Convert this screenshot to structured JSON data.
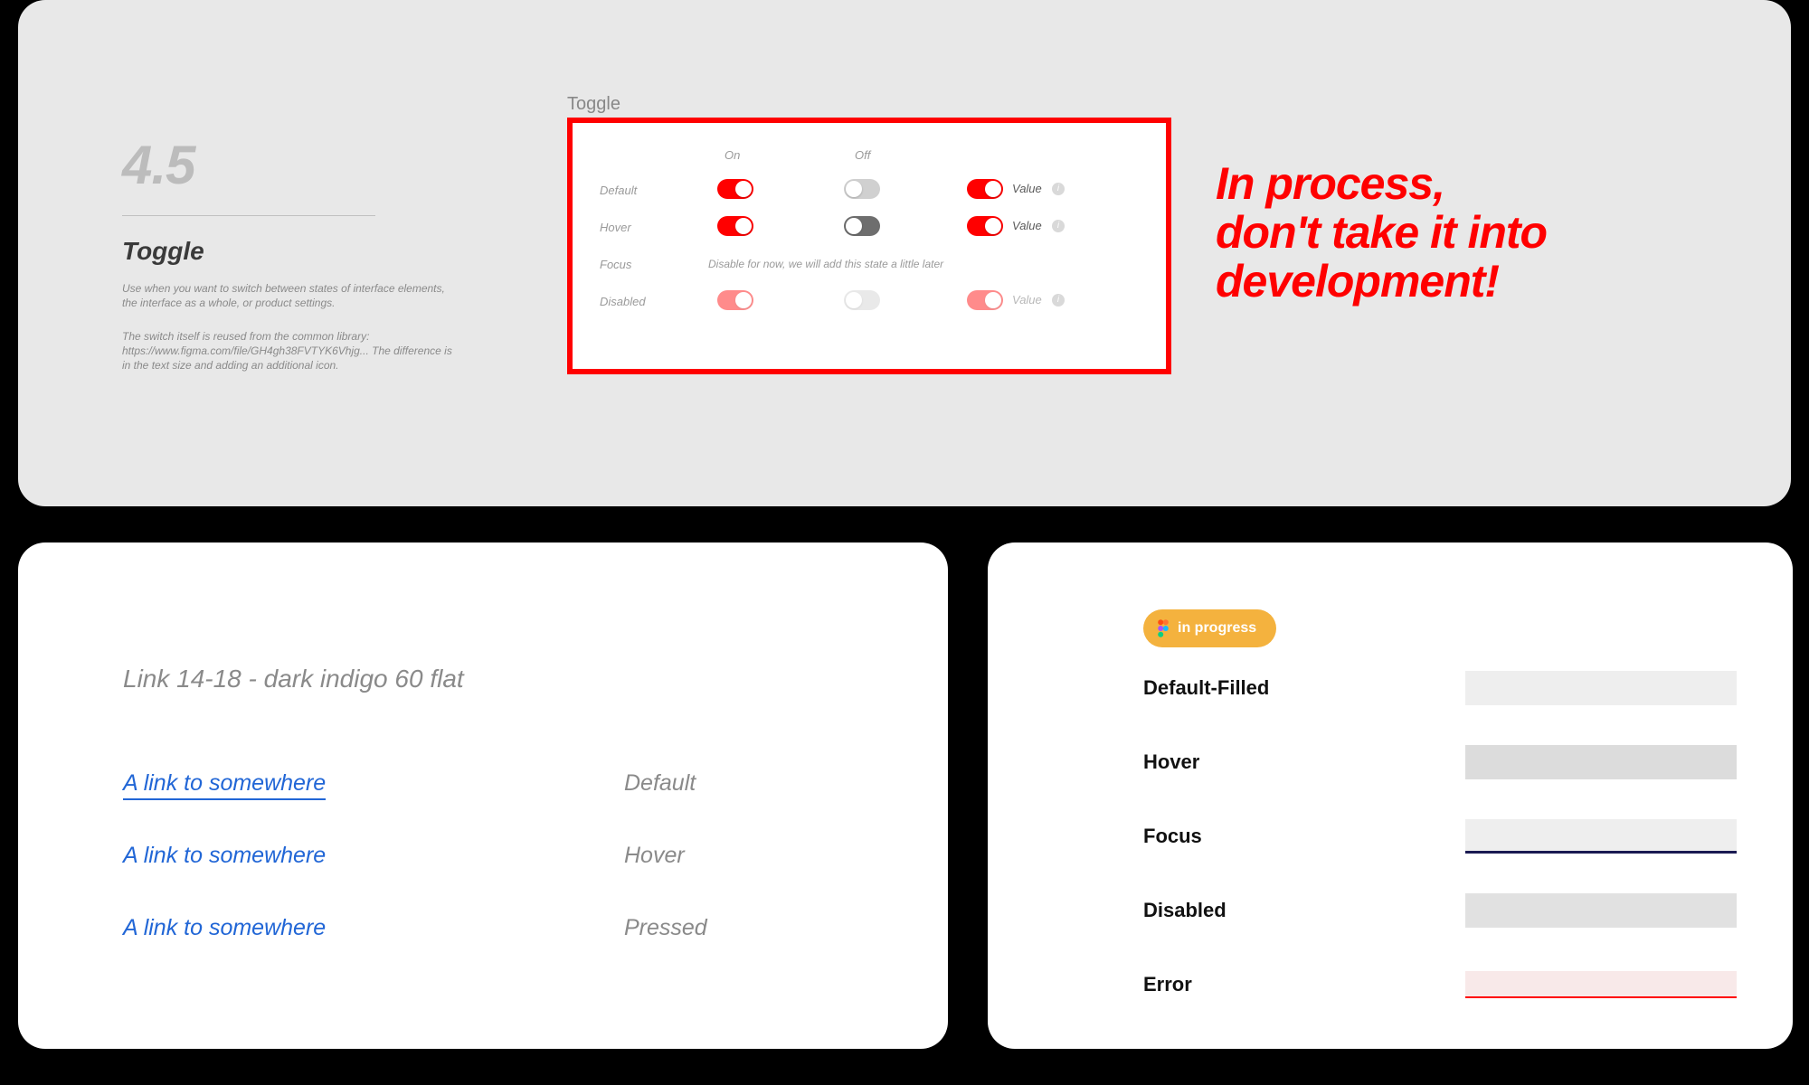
{
  "card1": {
    "section_number": "4.5",
    "section_title": "Toggle",
    "desc1": "Use when you want to switch between states of interface elements, the interface as a whole, or product settings.",
    "desc2": "The switch itself is reused from the common library: https://www.figma.com/file/GH4gh38FVTYK6Vhjg... The difference is in the text size and adding an additional icon.",
    "panel_label": "Toggle",
    "columns": {
      "on": "On",
      "off": "Off"
    },
    "rows": {
      "default": "Default",
      "hover": "Hover",
      "focus": "Focus",
      "disabled": "Disabled"
    },
    "focus_note": "Disable for now, we will add this state a little later",
    "value_label": "Value",
    "warning": "In process,\ndon't take it into\ndevelopment!"
  },
  "card2": {
    "title": "Link 14-18 - dark indigo 60 flat",
    "links": [
      {
        "text": "A link to somewhere",
        "state": "Default"
      },
      {
        "text": "A link to somewhere",
        "state": "Hover"
      },
      {
        "text": "A link to somewhere",
        "state": "Pressed"
      }
    ]
  },
  "card3": {
    "badge": "in progress",
    "inputs": [
      {
        "label": "Default-Filled",
        "variant": "default"
      },
      {
        "label": "Hover",
        "variant": "hover"
      },
      {
        "label": "Focus",
        "variant": "focus"
      },
      {
        "label": "Disabled",
        "variant": "disabled"
      },
      {
        "label": "Error",
        "variant": "error"
      }
    ]
  }
}
